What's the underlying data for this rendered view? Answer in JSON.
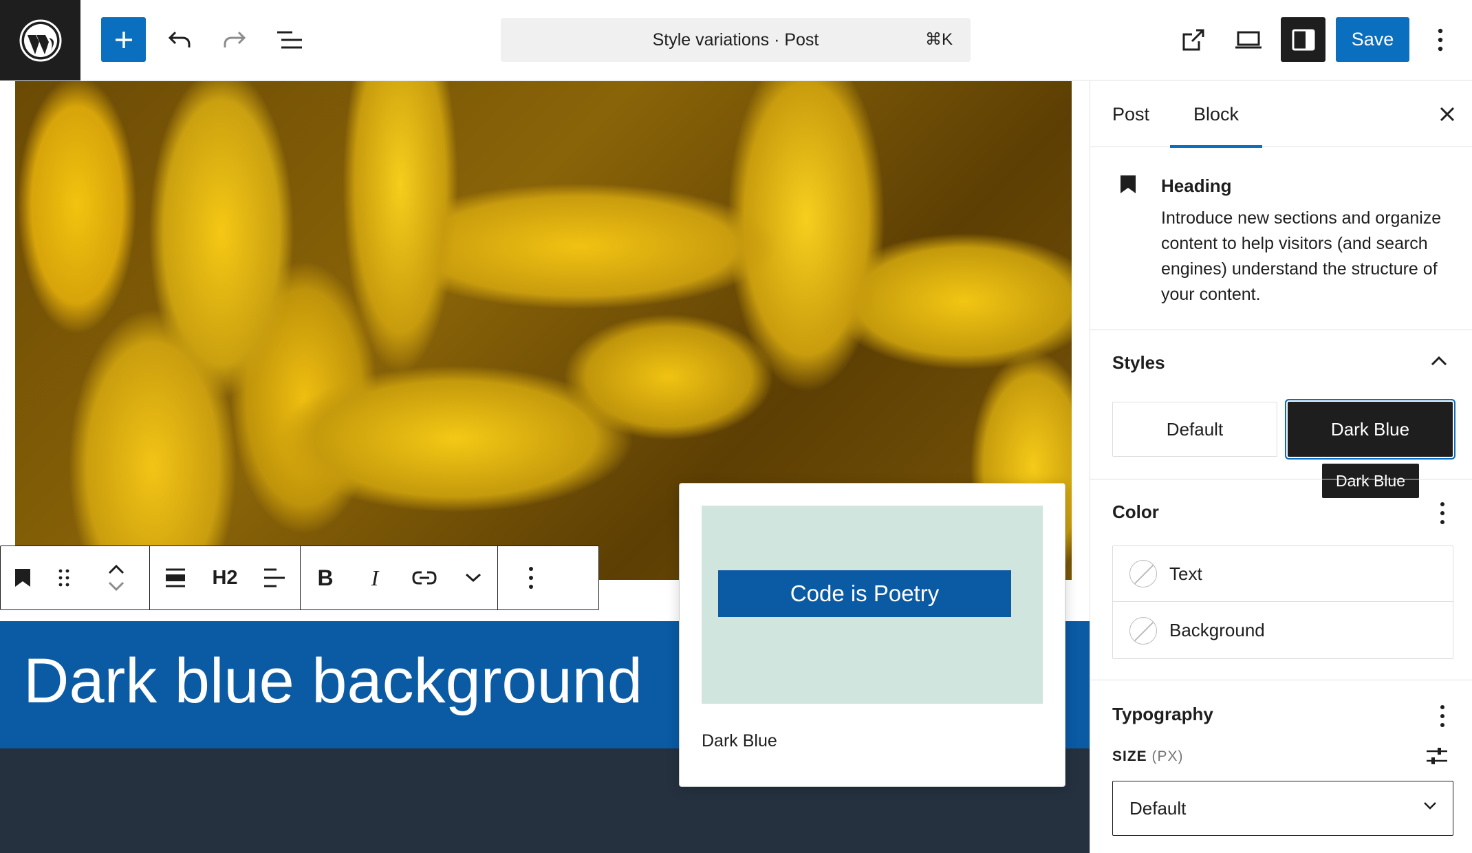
{
  "header": {
    "command_title": "Style variations · Post",
    "command_shortcut": "⌘K",
    "save_label": "Save"
  },
  "canvas": {
    "heading_text": "Dark blue background",
    "toolbar": {
      "heading_level": "H2",
      "bold": "B",
      "italic": "I"
    }
  },
  "preview": {
    "chip_text": "Code is Poetry",
    "label": "Dark Blue"
  },
  "sidebar": {
    "tabs": [
      {
        "label": "Post"
      },
      {
        "label": "Block"
      }
    ],
    "block_card": {
      "name": "Heading",
      "description": "Introduce new sections and organize content to help visitors (and search engines) understand the structure of your content."
    },
    "styles": {
      "title": "Styles",
      "options": [
        {
          "label": "Default"
        },
        {
          "label": "Dark Blue"
        }
      ],
      "tooltip": "Dark Blue"
    },
    "color": {
      "title": "Color",
      "items": [
        {
          "label": "Text"
        },
        {
          "label": "Background"
        }
      ]
    },
    "typography": {
      "title": "Typography",
      "size_label": "SIZE",
      "size_unit": "(PX)",
      "size_value": "Default"
    }
  },
  "colors": {
    "accent": "#0a6fbf",
    "dark_blue": "#0a5aa4",
    "preview_bg": "#d0e5de",
    "dark_bg": "#25313f"
  }
}
